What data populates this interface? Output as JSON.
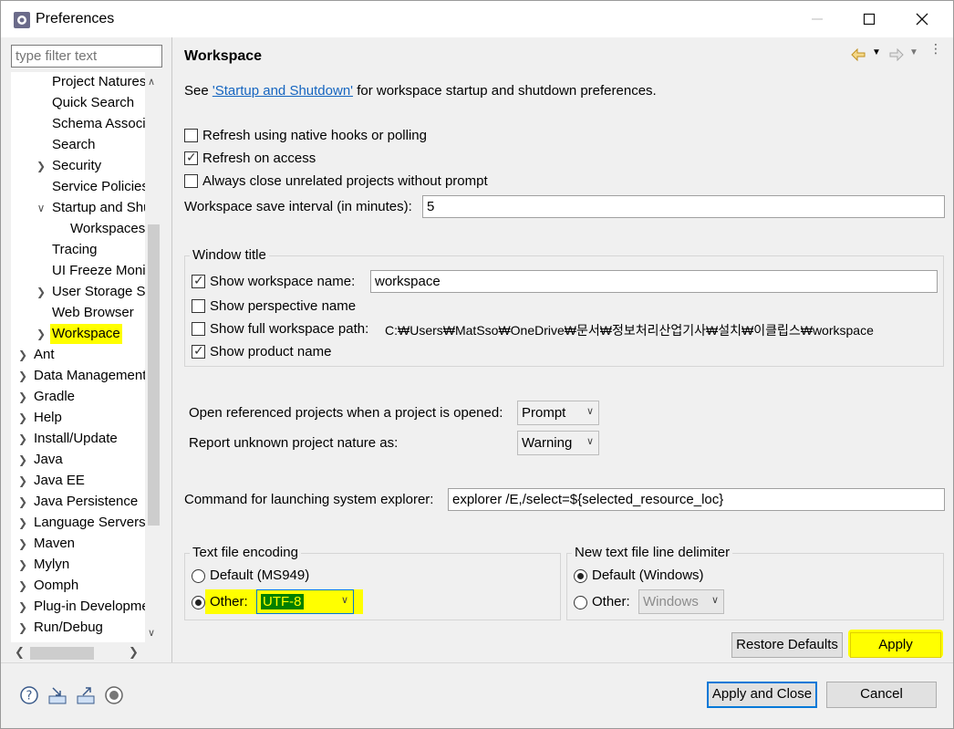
{
  "window": {
    "title": "Preferences",
    "minimize_icon": "minimize-icon",
    "maximize_icon": "maximize-icon",
    "close_icon": "close-icon"
  },
  "filter": {
    "placeholder": "type filter text"
  },
  "tree": {
    "items": [
      {
        "label": "Project Natures",
        "chevron": ""
      },
      {
        "label": "Quick Search",
        "chevron": ""
      },
      {
        "label": "Schema Associations",
        "chevron": ""
      },
      {
        "label": "Search",
        "chevron": ""
      },
      {
        "label": "Security",
        "chevron": ">"
      },
      {
        "label": "Service Policies",
        "chevron": ""
      },
      {
        "label": "Startup and Shutdown",
        "chevron": "v"
      },
      {
        "label": "Workspaces",
        "chevron": ""
      },
      {
        "label": "Tracing",
        "chevron": ""
      },
      {
        "label": "UI Freeze Monitoring",
        "chevron": ""
      },
      {
        "label": "User Storage Service",
        "chevron": ">"
      },
      {
        "label": "Web Browser",
        "chevron": ""
      },
      {
        "label": "Workspace",
        "chevron": ">"
      },
      {
        "label": "Ant",
        "chevron": ">"
      },
      {
        "label": "Data Management",
        "chevron": ">"
      },
      {
        "label": "Gradle",
        "chevron": ">"
      },
      {
        "label": "Help",
        "chevron": ">"
      },
      {
        "label": "Install/Update",
        "chevron": ">"
      },
      {
        "label": "Java",
        "chevron": ">"
      },
      {
        "label": "Java EE",
        "chevron": ">"
      },
      {
        "label": "Java Persistence",
        "chevron": ">"
      },
      {
        "label": "Language Servers",
        "chevron": ">"
      },
      {
        "label": "Maven",
        "chevron": ">"
      },
      {
        "label": "Mylyn",
        "chevron": ">"
      },
      {
        "label": "Oomph",
        "chevron": ">"
      },
      {
        "label": "Plug-in Development",
        "chevron": ">"
      },
      {
        "label": "Run/Debug",
        "chevron": ">"
      }
    ],
    "selected": "Workspace"
  },
  "page": {
    "title": "Workspace",
    "intro_prefix": "See ",
    "intro_link": "'Startup and Shutdown'",
    "intro_suffix": " for workspace startup and shutdown preferences.",
    "refresh_native": {
      "label": "Refresh using native hooks or polling",
      "checked": false
    },
    "refresh_access": {
      "label": "Refresh on access",
      "checked": true
    },
    "always_close": {
      "label": "Always close unrelated projects without prompt",
      "checked": false
    },
    "save_interval": {
      "label": "Workspace save interval (in minutes):",
      "value": "5"
    },
    "window_title_group": {
      "title": "Window title",
      "show_workspace_name": {
        "label": "Show workspace name:",
        "checked": true,
        "value": "workspace"
      },
      "show_perspective_name": {
        "label": "Show perspective name",
        "checked": false
      },
      "show_full_path": {
        "label": "Show full workspace path:",
        "checked": false,
        "value": "C:₩Users₩MatSso₩OneDrive₩문서₩정보처리산업기사₩설치₩이클립스₩workspace"
      },
      "show_product_name": {
        "label": "Show product name",
        "checked": true
      }
    },
    "open_referenced": {
      "label": "Open referenced projects when a project is opened:",
      "value": "Prompt"
    },
    "report_unknown": {
      "label": "Report unknown project nature as:",
      "value": "Warning"
    },
    "explorer_command": {
      "label": "Command for launching system explorer:",
      "value": "explorer /E,/select=${selected_resource_loc}"
    },
    "encoding_group": {
      "title": "Text file encoding",
      "default_label": "Default (MS949)",
      "other_label": "Other:",
      "other_value": "UTF-8",
      "selected": "other"
    },
    "delimiter_group": {
      "title": "New text file line delimiter",
      "default_label": "Default (Windows)",
      "other_label": "Other:",
      "other_value": "Windows",
      "selected": "default"
    },
    "restore_defaults": "Restore Defaults",
    "apply": "Apply"
  },
  "footer": {
    "apply_and_close": "Apply and Close",
    "cancel": "Cancel",
    "icons": [
      "help-icon",
      "import-icon",
      "export-icon",
      "record-icon"
    ]
  },
  "colors": {
    "highlight": "#ffff00",
    "link": "#1565c0",
    "accent": "#0078d7"
  }
}
